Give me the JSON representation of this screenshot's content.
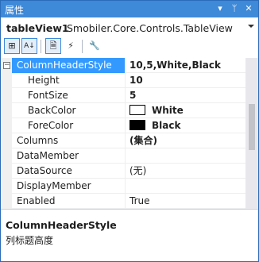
{
  "window": {
    "title": "属性",
    "pin_glyph": "▾",
    "autohide_glyph": "ᛘ",
    "close_glyph": "✕"
  },
  "selector": {
    "object_name": "tableView1",
    "object_type": "Smobiler.Core.Controls.TableView"
  },
  "toolbar": {
    "categorized_glyph": "⊞",
    "alphabetical_glyph": "A↓",
    "properties_glyph": "🗎",
    "events_glyph": "⚡",
    "property_pages_glyph": "🔧"
  },
  "colors": {
    "accent": "#3e89d8",
    "selection": "#3399ff",
    "white_swatch": "#ffffff",
    "black_swatch": "#000000"
  },
  "properties": {
    "column_header_style": {
      "name": "ColumnHeaderStyle",
      "value": "10,5,White,Black",
      "expander": "−"
    },
    "height": {
      "name": "Height",
      "value": "10"
    },
    "font_size": {
      "name": "FontSize",
      "value": "5"
    },
    "back_color": {
      "name": "BackColor",
      "value": "White"
    },
    "fore_color": {
      "name": "ForeColor",
      "value": "Black"
    },
    "columns": {
      "name": "Columns",
      "value": "(集合)"
    },
    "data_member": {
      "name": "DataMember",
      "value": ""
    },
    "data_source": {
      "name": "DataSource",
      "value": "(无)"
    },
    "display_member": {
      "name": "DisplayMember",
      "value": ""
    },
    "enabled": {
      "name": "Enabled",
      "value": "True"
    }
  },
  "description": {
    "title": "ColumnHeaderStyle",
    "text": "列标题高度"
  }
}
